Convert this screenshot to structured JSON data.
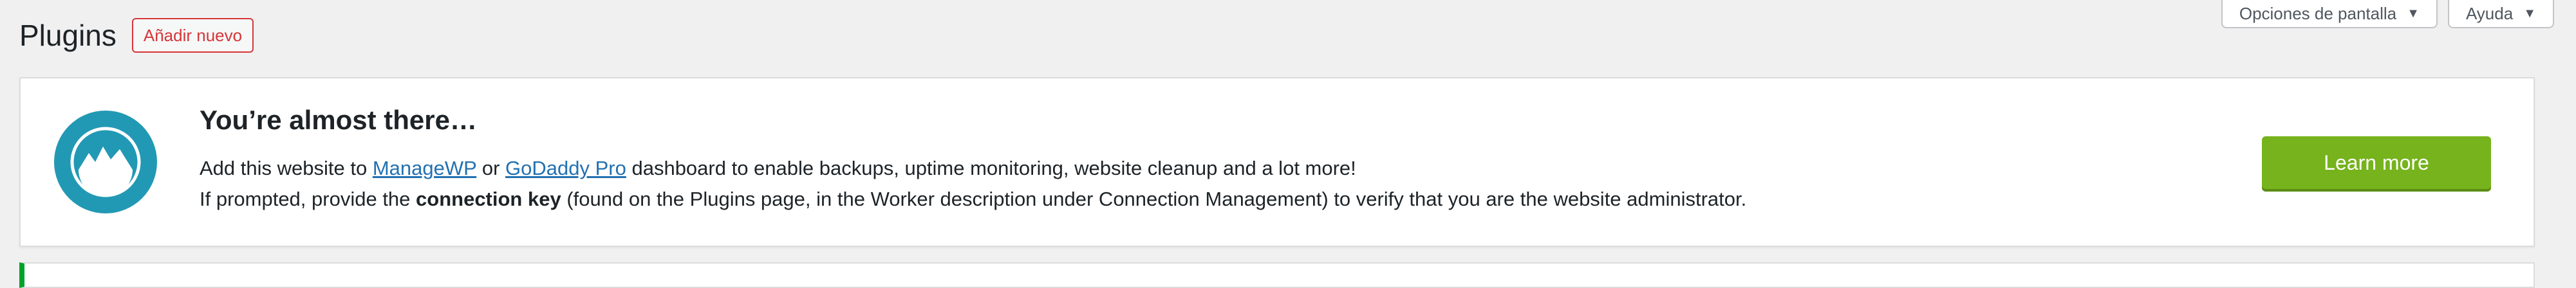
{
  "header": {
    "title": "Plugins",
    "add_new_label": "Añadir nuevo"
  },
  "screen_tabs": {
    "screen_options_label": "Opciones de pantalla",
    "help_label": "Ayuda",
    "caret": "▼"
  },
  "notice": {
    "title": "You’re almost there…",
    "line1_prefix": "Add this website to ",
    "link_managewp": "ManageWP",
    "line1_or": " or ",
    "link_godaddy": "GoDaddy Pro",
    "line1_suffix": " dashboard to enable backups, uptime monitoring, website cleanup and a lot more!",
    "line2_prefix": "If prompted, provide the ",
    "line2_bold": "connection key",
    "line2_suffix": " (found on the Plugins page, in the Worker description under Connection Management) to verify that you are the website administrator.",
    "learn_more_label": "Learn more",
    "logo_icon": "managewp-logo-icon"
  },
  "colors": {
    "background": "#f0f0f1",
    "accent_red": "#d63638",
    "link_blue": "#2271b1",
    "logo_teal": "#2299b4",
    "button_green": "#76b31c",
    "success_green": "#00a32a"
  }
}
